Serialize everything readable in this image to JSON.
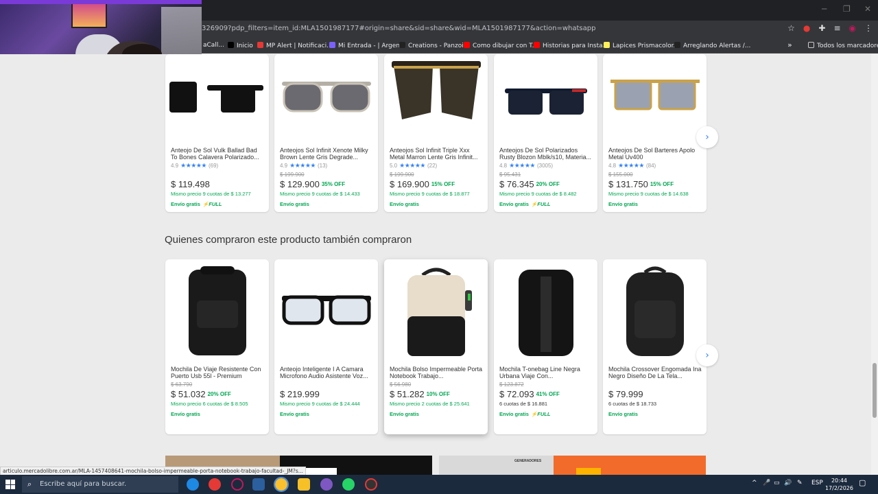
{
  "browser": {
    "url": "326909?pdp_filters=item_id:MLA1501987177#origin=share&sid=share&wid=MLA1501987177&action=whatsapp",
    "bookmarks": [
      {
        "label": "aCall...",
        "color": "#5f6368"
      },
      {
        "label": "Inicio",
        "color": "#000000"
      },
      {
        "label": "MP Alert | Notificaci...",
        "color": "#e53935"
      },
      {
        "label": "Mi Entrada - | Argen...",
        "color": "#7b61ff"
      },
      {
        "label": "Creations - Panzoid",
        "color": "#222222"
      },
      {
        "label": "Como dibujar con T...",
        "color": "#ff0000"
      },
      {
        "label": "Historias para Insta...",
        "color": "#ff0000"
      },
      {
        "label": "Lapices Prismacolor...",
        "color": "#fff159"
      },
      {
        "label": "Arreglando Alertas /...",
        "color": "#222222"
      }
    ],
    "more_bookmarks": "»",
    "all_bookmarks": "Todos los marcadores",
    "status_url": "articulo.mercadolibre.com.ar/MLA-1457408641-mochila-bolso-impermeable-porta-notebook-trabajo-facultad-_JM?s..."
  },
  "carousel1": {
    "products": [
      {
        "title": "Anteojo De Sol Vulk Ballad Bad To Bones Calavera Polarizado...",
        "rating": "4.9",
        "reviews": "(69)",
        "old_price": "",
        "price": "$ 119.498",
        "discount": "",
        "installments": "Mismo precio 9 cuotas de $ 13.277",
        "shipping": "Envío gratis",
        "full": "FULL"
      },
      {
        "title": "Anteojos Sol Infinit Xenote Milky Brown Lente Gris Degrade...",
        "rating": "4.9",
        "reviews": "(13)",
        "old_price": "$ 199.900",
        "price": "$ 129.900",
        "discount": "35% OFF",
        "installments": "Mismo precio 9 cuotas de $ 14.433",
        "shipping": "Envío gratis",
        "full": ""
      },
      {
        "title": "Anteojos Sol Infinit Triple Xxx Metal Marron Lente Gris Infinit...",
        "rating": "5.0",
        "reviews": "(22)",
        "old_price": "$ 199.900",
        "price": "$ 169.900",
        "discount": "15% OFF",
        "installments": "Mismo precio 9 cuotas de $ 18.877",
        "shipping": "Envío gratis",
        "full": ""
      },
      {
        "title": "Anteojos De Sol Polarizados Rusty Blozon Mblk/s10, Materia...",
        "rating": "4.8",
        "reviews": "(3005)",
        "old_price": "$ 95.431",
        "price": "$ 76.345",
        "discount": "20% OFF",
        "installments": "Mismo precio 9 cuotas de $ 8.482",
        "shipping": "Envío gratis",
        "full": "FULL"
      },
      {
        "title": "Anteojos De Sol Barteres Apolo Metal Uv400",
        "rating": "4.8",
        "reviews": "(84)",
        "old_price": "$ 155.000",
        "price": "$ 131.750",
        "discount": "15% OFF",
        "installments": "Mismo precio 9 cuotas de $ 14.638",
        "shipping": "Envío gratis",
        "full": ""
      }
    ]
  },
  "section2": {
    "title": "Quienes compraron este producto también compraron",
    "products": [
      {
        "title": "Mochila De Viaje Resistente Con Puerto Usb 55l - Premium",
        "old_price": "$ 63.790",
        "price": "$ 51.032",
        "discount": "20% OFF",
        "installments": "Mismo precio 6 cuotas de $ 8.505",
        "installments_plain": false,
        "shipping": "Envío gratis",
        "full": ""
      },
      {
        "title": "Anteojo Inteligente I A Camara Microfono Audio Asistente Voz...",
        "old_price": "",
        "price": "$ 219.999",
        "discount": "",
        "installments": "Mismo precio 9 cuotas de $ 24.444",
        "installments_plain": false,
        "shipping": "Envío gratis",
        "full": ""
      },
      {
        "title": "Mochila Bolso Impermeable Porta Notebook Trabajo...",
        "old_price": "$ 56.980",
        "price": "$ 51.282",
        "discount": "10% OFF",
        "installments": "Mismo precio 2 cuotas de $ 25.641",
        "installments_plain": false,
        "shipping": "Envío gratis",
        "full": ""
      },
      {
        "title": "Mochila T-onebag Line Negra Urbana Viaje Con...",
        "old_price": "$ 123.872",
        "price": "$ 72.093",
        "discount": "41% OFF",
        "installments": "6 cuotas de $ 16.881",
        "installments_plain": true,
        "shipping": "Envío gratis",
        "full": "FULL"
      },
      {
        "title": "Mochila Crossover Engomada Ina Negro Diseño De La Tela...",
        "old_price": "",
        "price": "$ 79.999",
        "discount": "",
        "installments": "6 cuotas de $ 18.733",
        "installments_plain": true,
        "shipping": "Envío gratis",
        "full": ""
      }
    ]
  },
  "banner_label": "GENERADORES",
  "taskbar": {
    "search_placeholder": "Escribe aquí para buscar.",
    "lang": "ESP",
    "time": "20:44",
    "date": "17/2/2026"
  },
  "colors": {
    "accent": "#3483fa",
    "green": "#00a650",
    "background": "#ebebeb"
  }
}
